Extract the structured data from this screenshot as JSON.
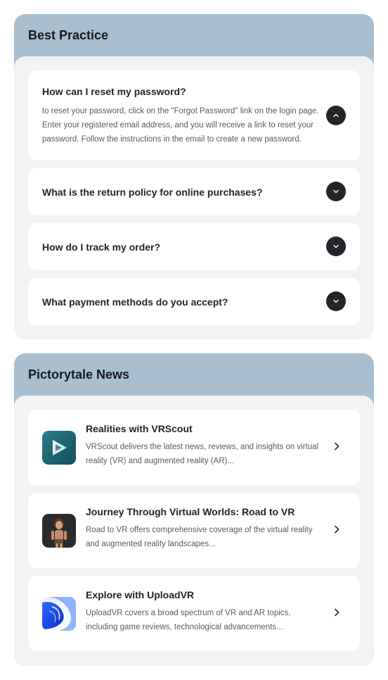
{
  "faq": {
    "title": "Best Practice",
    "items": [
      {
        "question": "How can I reset my password?",
        "answer": "to reset your password, click on the \"Forgot Password\" link on the login page. Enter your registered email address, and you will receive a link to reset your password. Follow the instructions in the email to create a new password.",
        "expanded": true,
        "toggle_icon": "chevron-up-icon"
      },
      {
        "question": "What is the return policy for online purchases?",
        "expanded": false,
        "toggle_icon": "chevron-down-icon"
      },
      {
        "question": "How do I track my order?",
        "expanded": false,
        "toggle_icon": "chevron-down-icon"
      },
      {
        "question": "What payment methods do you accept?",
        "expanded": false,
        "toggle_icon": "chevron-down-icon"
      }
    ]
  },
  "news": {
    "title": "Pictorytale News",
    "items": [
      {
        "title": "Realities with VRScout",
        "description": "VRScout delivers the latest news, reviews, and insights on virtual reality (VR) and augmented reality (AR)...",
        "thumbnail": "vrscout-logo"
      },
      {
        "title": "Journey Through Virtual Worlds: Road to VR",
        "description": "Road to VR offers comprehensive coverage of the virtual reality and augmented reality landscapes...",
        "thumbnail": "road-to-vr-character"
      },
      {
        "title": "Explore with UploadVR",
        "description": " UploadVR covers a broad spectrum of VR and AR topics, including game reviews, technological advancements...",
        "thumbnail": "uploadvr-logo"
      }
    ]
  },
  "colors": {
    "header_bg": "#a9bfd0",
    "body_bg": "#f2f3f5",
    "toggle_bg": "#23272c",
    "page_bg": "#ffffff"
  }
}
